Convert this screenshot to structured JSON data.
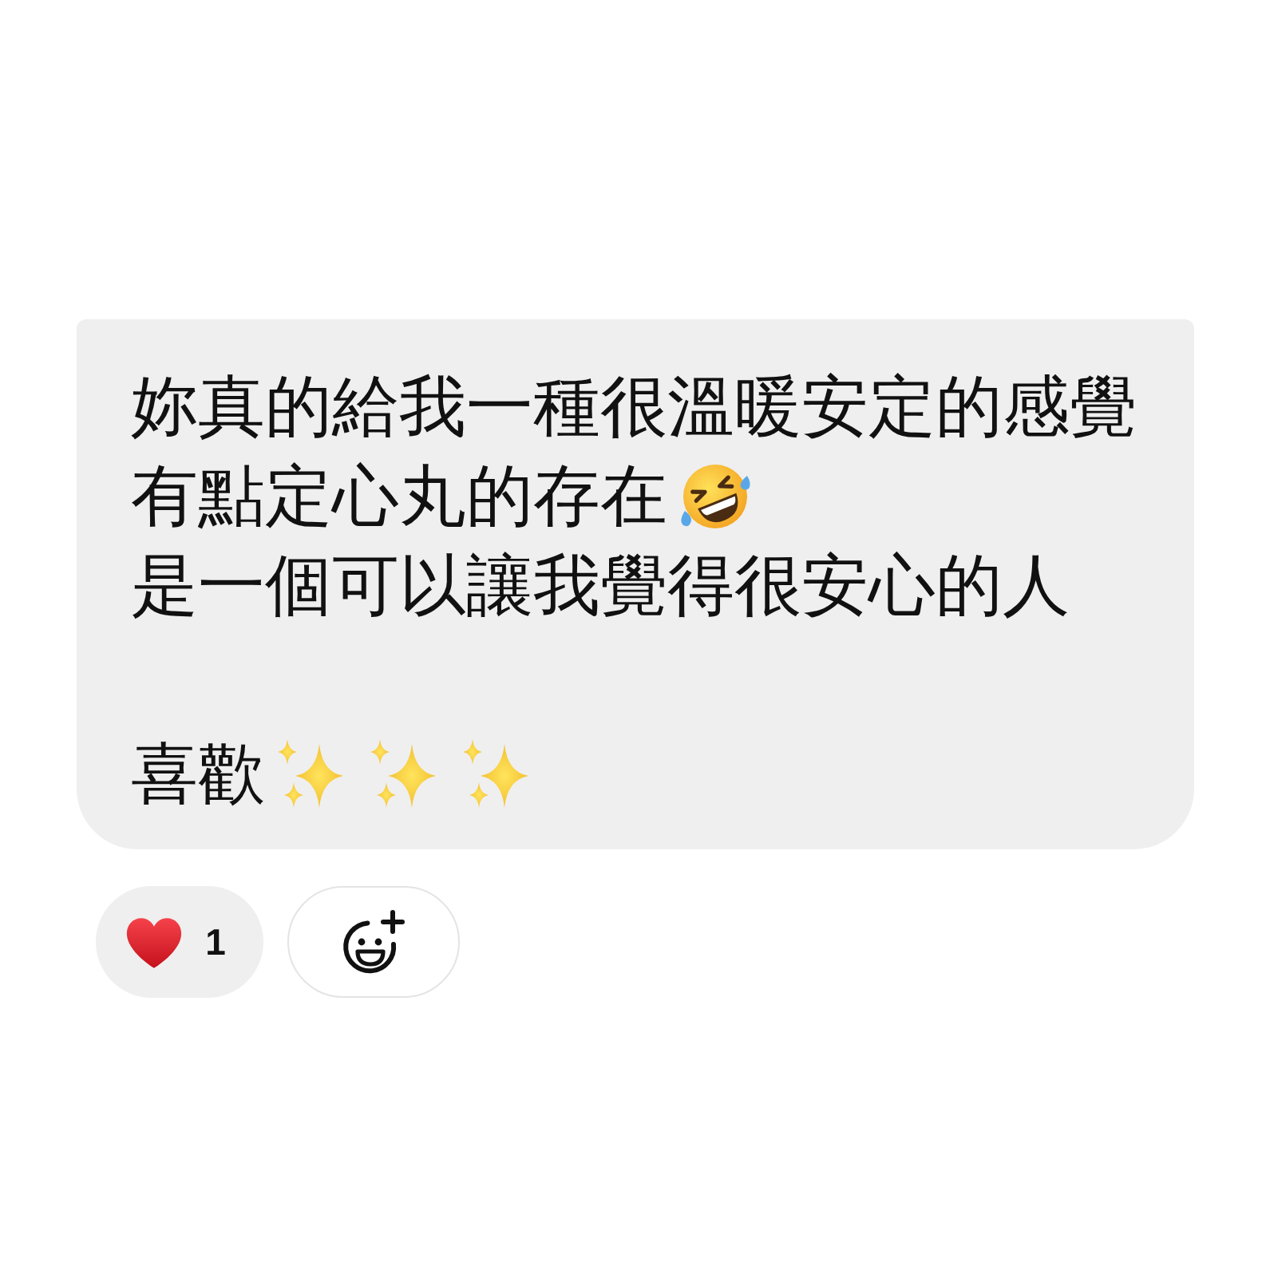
{
  "message": {
    "paragraphs": [
      {
        "lines": [
          {
            "text": "妳真的給我一種很溫暖安定的感覺"
          },
          {
            "text": "有點定心丸的存在",
            "emoji": [
              {
                "kind": "laugh"
              }
            ]
          },
          {
            "text": "是一個可以讓我覺得很安心的人"
          }
        ]
      },
      {
        "lines": [
          {
            "text": "喜歡",
            "emoji": [
              {
                "kind": "sparkles"
              },
              {
                "kind": "sparkles"
              },
              {
                "kind": "sparkles"
              }
            ]
          }
        ]
      }
    ]
  },
  "reactions": [
    {
      "kind": "heart",
      "count": "1"
    },
    {
      "kind": "add"
    }
  ]
}
